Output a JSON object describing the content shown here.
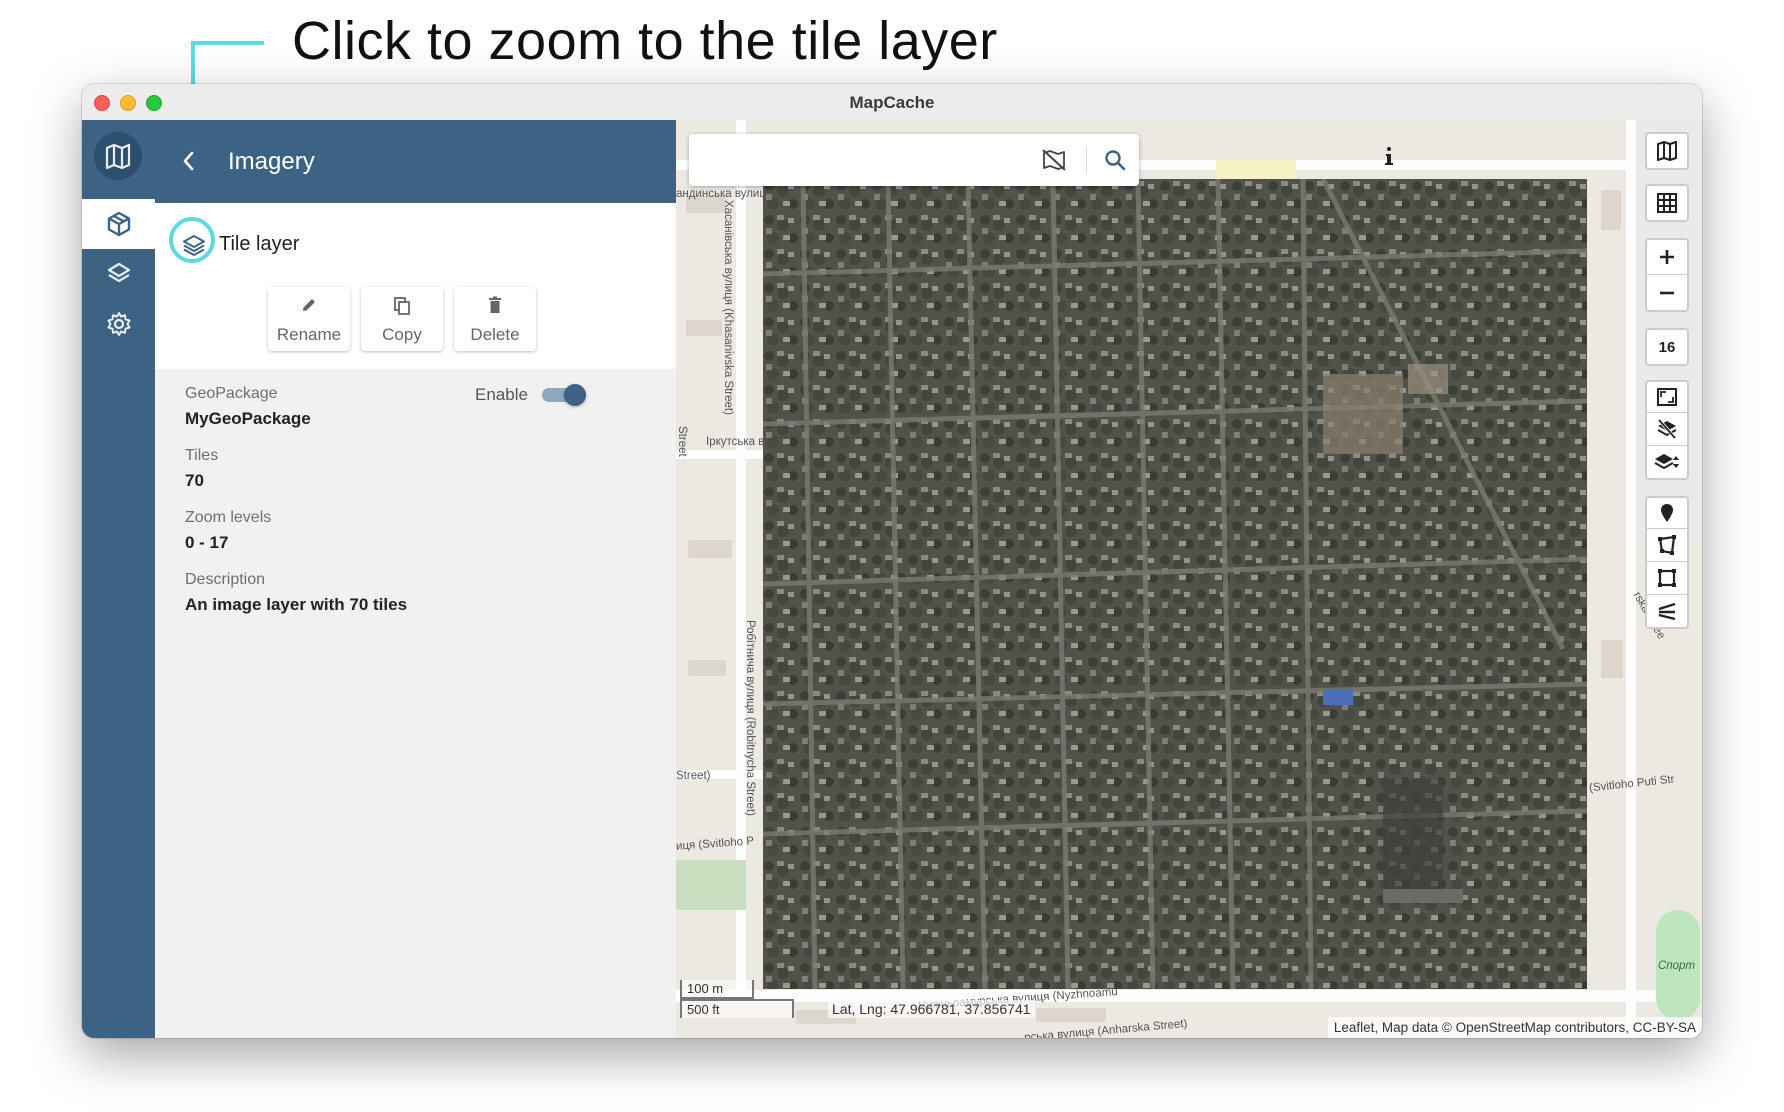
{
  "annotation": {
    "text": "Click to zoom to the tile layer"
  },
  "window": {
    "title": "MapCache"
  },
  "panel": {
    "title": "Imagery",
    "layer_name": "Tile layer",
    "buttons": {
      "rename": "Rename",
      "copy": "Copy",
      "delete": "Delete"
    },
    "details": {
      "geopackage_label": "GeoPackage",
      "geopackage_value": "MyGeoPackage",
      "enable_label": "Enable",
      "enabled": true,
      "tiles_label": "Tiles",
      "tiles_value": "70",
      "zoom_label": "Zoom levels",
      "zoom_value": "0 - 17",
      "description_label": "Description",
      "description_value": "An image layer with 70 tiles"
    }
  },
  "map": {
    "zoom_level": "16",
    "scale_metric": "100 m",
    "scale_imperial": "500 ft",
    "coordinates": "Lat, Lng: 47.966781, 37.856741",
    "attribution": "Leaflet, Map data © OpenStreetMap contributors, CC-BY-SA",
    "street_labels": {
      "s1": "андинська вулиц",
      "s2": "Хасанівська вулиця (Khasanivska Street)",
      "s3": "Іркутська в",
      "s4": "Street)",
      "s5": "Робітнича вулиця (Robitnycha Street)",
      "s6": "Street)",
      "s7": "иця (Svitloho P",
      "s8": "Нижньоамурська вулиця (Nyzhnoamu",
      "s9": "рська вулиця (Anharska Street)",
      "s10": "(Svitloho Puti Str",
      "s11": "Спорт",
      "s12": "rska Stree",
      "s13": "Street"
    }
  },
  "colors": {
    "accent": "#3d6384",
    "annotation": "#5fd8e6"
  }
}
